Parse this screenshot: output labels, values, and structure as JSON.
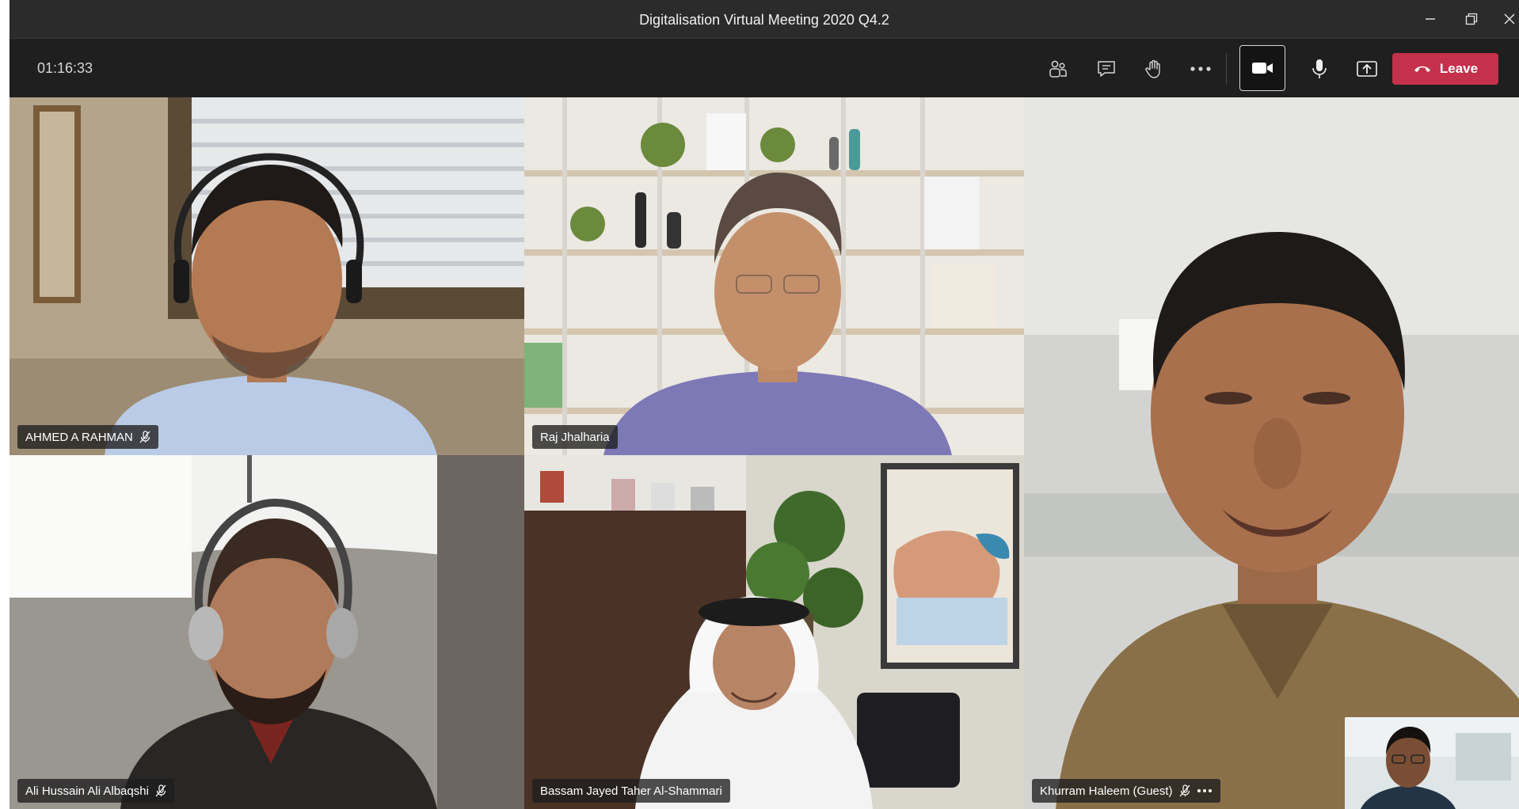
{
  "window": {
    "title": "Digitalisation Virtual Meeting 2020 Q4.2",
    "controls": [
      "minimize-icon",
      "restore-icon",
      "close-icon"
    ]
  },
  "toolbar": {
    "timer": "01:16:33",
    "buttons": [
      "participants-icon",
      "chat-icon",
      "raise-hand-icon",
      "more-options-icon",
      "camera-icon",
      "microphone-icon",
      "share-screen-icon"
    ],
    "leave_label": "Leave",
    "leave_color": "#c4314b"
  },
  "participants": [
    {
      "name": "AHMED A RAHMAN",
      "muted": true
    },
    {
      "name": "Raj Jhalharia",
      "muted": false
    },
    {
      "name": "Khurram Haleem (Guest)",
      "muted": true,
      "more_menu": true
    },
    {
      "name": "Ali Hussain Ali Albaqshi",
      "muted": true
    },
    {
      "name": "Bassam Jayed Taher Al-Shammari",
      "muted": false
    }
  ],
  "self_view": {
    "visible": true
  }
}
